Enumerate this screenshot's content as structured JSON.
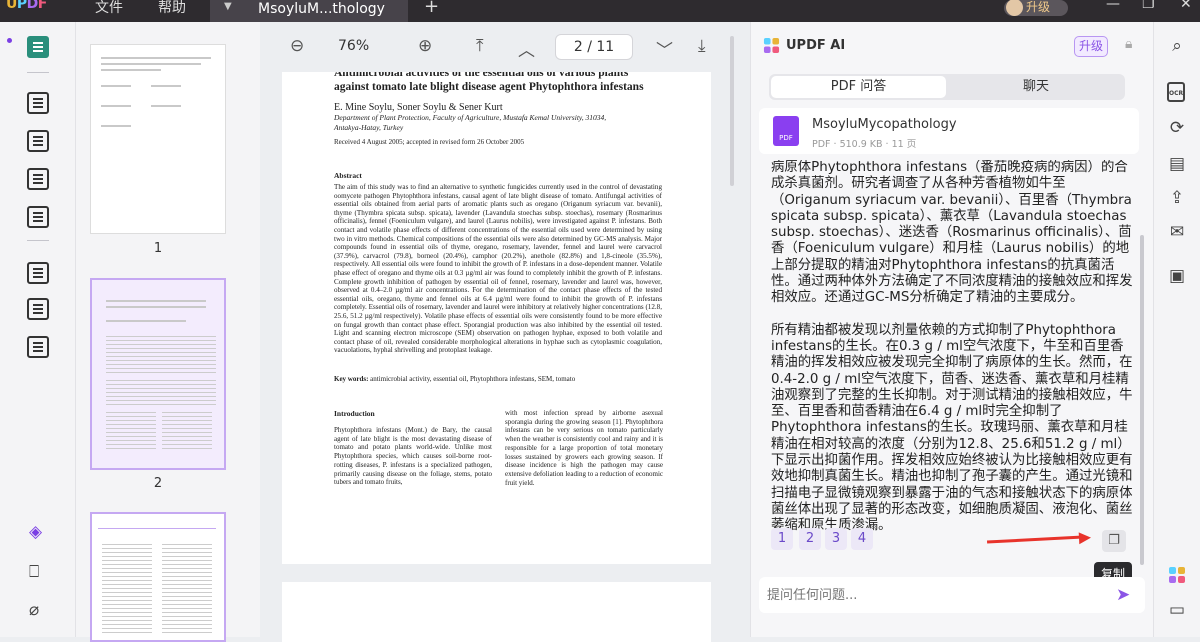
{
  "titlebar": {
    "logo": "UPDF",
    "menu_file": "文件",
    "menu_help": "帮助",
    "tab_title": "MsoyluM...thology",
    "tab_dot": "▼",
    "new_tab": "+",
    "upgrade": "升级"
  },
  "leftbar": {
    "items": [
      "reader-icon",
      "comment-icon",
      "edit-icon",
      "form-icon",
      "sign-icon",
      "organize-icon",
      "crop-icon",
      "compress-icon",
      "layers-icon",
      "bookmark-icon",
      "attachment-icon"
    ]
  },
  "thumbnails": {
    "pages": [
      "1",
      "2"
    ]
  },
  "toolbar": {
    "zoom": "76%",
    "current_page": "2",
    "page_sep": "/",
    "total_pages": "11"
  },
  "document": {
    "title_line1": "Antimicrobial activities of the essential oils of various plants",
    "title_line2": "against tomato late blight disease agent Phytophthora infestans",
    "authors": "E. Mine Soylu, Soner Soylu & Sener Kurt",
    "affiliation": "Department of Plant Protection, Faculty of Agriculture, Mustafa Kemal University, 31034, Antakya-Hatay, Turkey",
    "received": "Received 4 August 2005; accepted in revised form 26 October 2005",
    "abstract_heading": "Abstract",
    "abstract": "The aim of this study was to find an alternative to synthetic fungicides currently used in the control of devastating oomycete pathogen Phytophthora infestans, causal agent of late blight disease of tomato. Antifungal activities of essential oils obtained from aerial parts of aromatic plants such as oregano (Origanum syriacum var. bevanii), thyme (Thymbra spicata subsp. spicata), lavender (Lavandula stoechas subsp. stoechas), rosemary (Rosmarinus officinalis), fennel (Foeniculum vulgare), and laurel (Laurus nobilis), were investigated against P. infestans. Both contact and volatile phase effects of different concentrations of the essential oils used were determined by using two in vitro methods. Chemical compositions of the essential oils were also determined by GC-MS analysis. Major compounds found in essential oils of thyme, oregano, rosemary, lavender, fennel and laurel were carvacrol (37.9%), carvacrol (79.8), borneol (20.4%), camphor (20.2%), anethole (82.8%) and 1,8-cineole (35.5%), respectively. All essential oils were found to inhibit the growth of P. infestans in a dose-dependent manner. Volatile phase effect of oregano and thyme oils at 0.3 µg/ml air was found to completely inhibit the growth of P. infestans. Complete growth inhibition of pathogen by essential oil of fennel, rosemary, lavender and laurel was, however, observed at 0.4–2.0 µg/ml air concentrations. For the determination of the contact phase effects of the tested essential oils, oregano, thyme and fennel oils at 6.4 µg/ml were found to inhibit the growth of P. infestans completely. Essential oils of rosemary, lavender and laurel were inhibitory at relatively higher concentrations (12.8, 25.6, 51.2 µg/ml respectively). Volatile phase effects of essential oils were consistently found to be more effective on fungal growth than contact phase effect. Sporangial production was also inhibited by the essential oil tested. Light and scanning electron microscope (SEM) observation on pathogen hyphae, exposed to both volatile and contact phase of oil, revealed considerable morphological alterations in hyphae such as cytoplasmic coagulation, vacuolations, hyphal shrivelling and protoplast leakage.",
    "keywords_label": "Key words:",
    "keywords": "antimicrobial activity, essential oil, Phytophthora infestans, SEM, tomato",
    "intro_heading": "Introduction",
    "intro_col1": "Phytophthora infestans (Mont.) de Bary, the causal agent of late blight is the most devastating disease of tomato and potato plants world-wide. Unlike most Phytophthora species, which causes soil-borne root-rotting diseases, P. infestans is a specialized pathogen, primarily causing disease on the foliage, stems, potato tubers and tomato fruits,",
    "intro_col2": "with most infection spread by airborne asexual sporangia during the growing season [1]. Phytophthora infestans can be very serious on tomato particularly when the weather is consistently cool and rainy and it is responsible for a large proportion of total monetary losses sustained by growers each growing season. If disease incidence is high the pathogen may cause extensive defoliation leading to a reduction of economic fruit yield."
  },
  "ai_panel": {
    "title": "UPDF AI",
    "upgrade": "升级",
    "tab_pdf_qa": "PDF 问答",
    "tab_chat": "聊天",
    "file_name": "MsoyluMycopathology",
    "file_meta": "PDF · 510.9 KB · 11 页",
    "pdf_badge": "PDF",
    "answer_p1": "病原体Phytophthora infestans（番茄晚疫病的病因）的合成杀真菌剂。研究者调查了从各种芳香植物如牛至（Origanum syriacum var. bevanii）、百里香（Thymbra spicata subsp. spicata）、薰衣草（Lavandula stoechas subsp. stoechas）、迷迭香（Rosmarinus officinalis）、茴香（Foeniculum vulgare）和月桂（Laurus nobilis）的地上部分提取的精油对Phytophthora infestans的抗真菌活性。通过两种体外方法确定了不同浓度精油的接触效应和挥发相效应。还通过GC-MS分析确定了精油的主要成分。",
    "answer_p2": "所有精油都被发现以剂量依赖的方式抑制了Phytophthora infestans的生长。在0.3 g / ml空气浓度下，牛至和百里香精油的挥发相效应被发现完全抑制了病原体的生长。然而，在0.4-2.0 g / ml空气浓度下，茴香、迷迭香、薰衣草和月桂精油观察到了完整的生长抑制。对于测试精油的接触相效应，牛至、百里香和茴香精油在6.4 g / ml时完全抑制了Phytophthora infestans的生长。玫瑰玛丽、薰衣草和月桂精油在相对较高的浓度（分别为12.8、25.6和51.2 g / ml）下显示出抑菌作用。挥发相效应始终被认为比接触相效应更有效地抑制真菌生长。精油也抑制了孢子囊的产生。通过光镜和扫描电子显微镜观察到暴露于油的气态和接触状态下的病原体菌丝体出现了显著的形态改变，如细胞质凝固、液泡化、菌丝萎缩和原生质渗漏。",
    "refs": [
      "1",
      "2",
      "3",
      "4"
    ],
    "copy_tooltip": "复制",
    "ask_placeholder": "提问任何问题..."
  },
  "colors": {
    "accent": "#8b55e6",
    "annotation_arrow": "#e8332b",
    "active_tool": "#2a8f7c"
  }
}
